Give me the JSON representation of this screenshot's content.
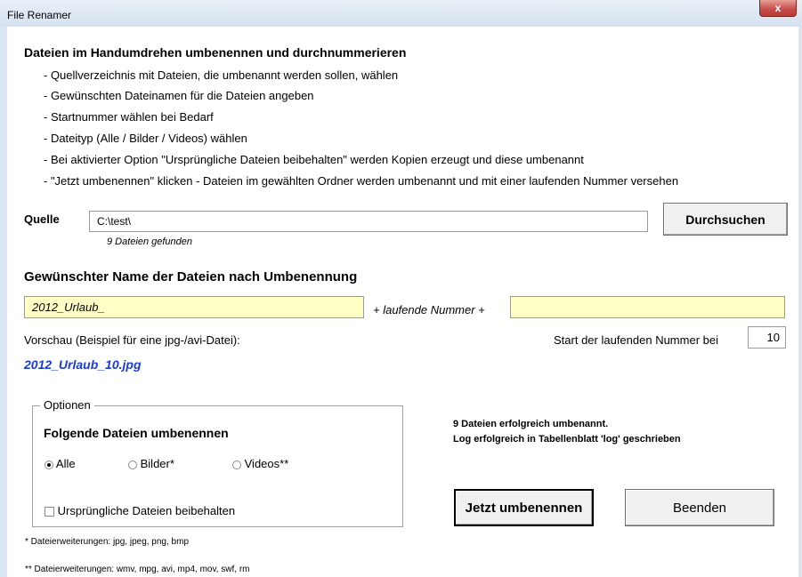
{
  "window": {
    "title": "File Renamer",
    "close_label": "x"
  },
  "intro": {
    "heading": "Dateien im Handumdrehen umbenennen und durchnummerieren",
    "steps": [
      "- Quellverzeichnis mit Dateien, die umbenannt werden sollen, wählen",
      "- Gewünschten Dateinamen für die Dateien angeben",
      "- Startnummer wählen bei Bedarf",
      "- Dateityp (Alle / Bilder / Videos) wählen",
      "- Bei aktivierter Option \"Ursprüngliche Dateien beibehalten\" werden Kopien erzeugt und diese umbenannt",
      "- \"Jetzt umbenennen\" klicken - Dateien im gewählten Ordner werden umbenannt und mit einer laufenden Nummer versehen"
    ]
  },
  "source": {
    "label": "Quelle",
    "path": "C:\\test\\",
    "files_found": "9 Dateien gefunden",
    "browse_label": "Durchsuchen"
  },
  "naming": {
    "heading": "Gewünschter Name der Dateien nach Umbenennung",
    "prefix": "2012_Urlaub_",
    "separator": "+ laufende Nummer +",
    "suffix": "",
    "preview_label": "Vorschau (Beispiel für eine jpg-/avi-Datei):",
    "preview_value": "2012_Urlaub_10.jpg",
    "start_label": "Start der laufenden Nummer bei",
    "start_value": "10"
  },
  "options": {
    "legend": "Optionen",
    "heading": "Folgende Dateien umbenennen",
    "radios": [
      {
        "label": "Alle",
        "checked": true
      },
      {
        "label": "Bilder*",
        "checked": false
      },
      {
        "label": "Videos**",
        "checked": false
      }
    ],
    "keep_originals_label": "Ursprüngliche Dateien beibehalten",
    "keep_originals_checked": false
  },
  "status": {
    "line1": "9 Dateien erfolgreich umbenannt.",
    "line2": "Log erfolgreich in Tabellenblatt 'log' geschrieben"
  },
  "actions": {
    "rename_label": "Jetzt umbenennen",
    "quit_label": "Beenden"
  },
  "footnotes": {
    "images": "* Dateierweiterungen: jpg, jpeg, png, bmp",
    "videos": "** Dateierweiterungen: wmv, mpg, avi, mp4, mov, swf, rm"
  }
}
